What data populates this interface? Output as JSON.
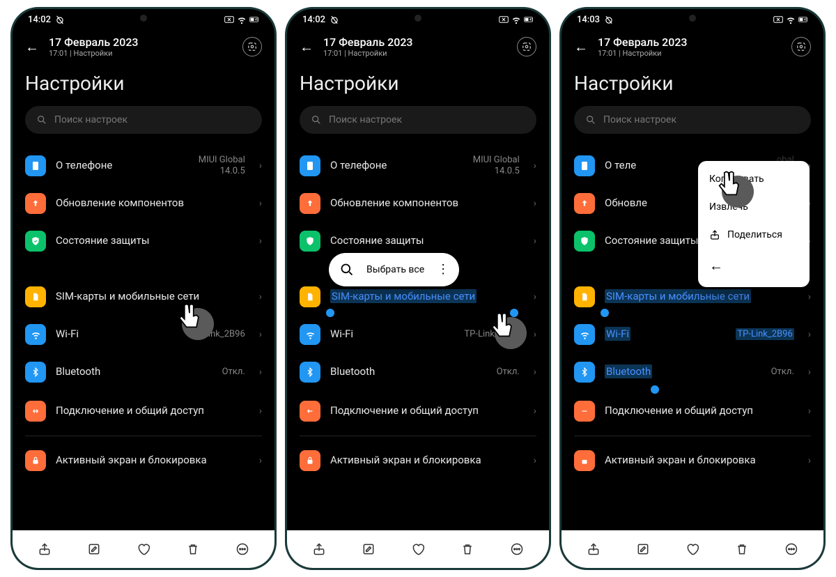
{
  "status": {
    "time1": "14:02",
    "time2": "14:02",
    "time3": "14:03",
    "battery": "43"
  },
  "header": {
    "date": "17 Февраль 2023",
    "sub": "17:01 | Настройки"
  },
  "page_title": "Настройки",
  "search": {
    "placeholder": "Поиск настроек"
  },
  "rows": {
    "about": {
      "label": "О телефоне",
      "value": "MIUI Global\n14.0.5"
    },
    "update": {
      "label": "Обновление компонентов"
    },
    "security": {
      "label": "Состояние защиты"
    },
    "sim": {
      "label": "SIM-карты и мобильные сети"
    },
    "wifi": {
      "label": "Wi-Fi",
      "value": "TP-Link_2B96"
    },
    "bt": {
      "label": "Bluetooth",
      "value": "Откл."
    },
    "conn": {
      "label": "Подключение и общий доступ"
    },
    "lock": {
      "label": "Активный экран и блокировка"
    }
  },
  "pill": {
    "select_all": "Выбрать все"
  },
  "menu": {
    "copy": "Копировать",
    "extract": "Извлечь",
    "share": "Поделиться"
  },
  "icon_colors": {
    "about": "#2196f3",
    "update": "#ff6d3a",
    "security": "#0bc26a",
    "sim": "#ffb300",
    "wifi": "#2196f3",
    "bt": "#2196f3",
    "conn": "#ff6d3a",
    "lock": "#ff6d3a"
  }
}
